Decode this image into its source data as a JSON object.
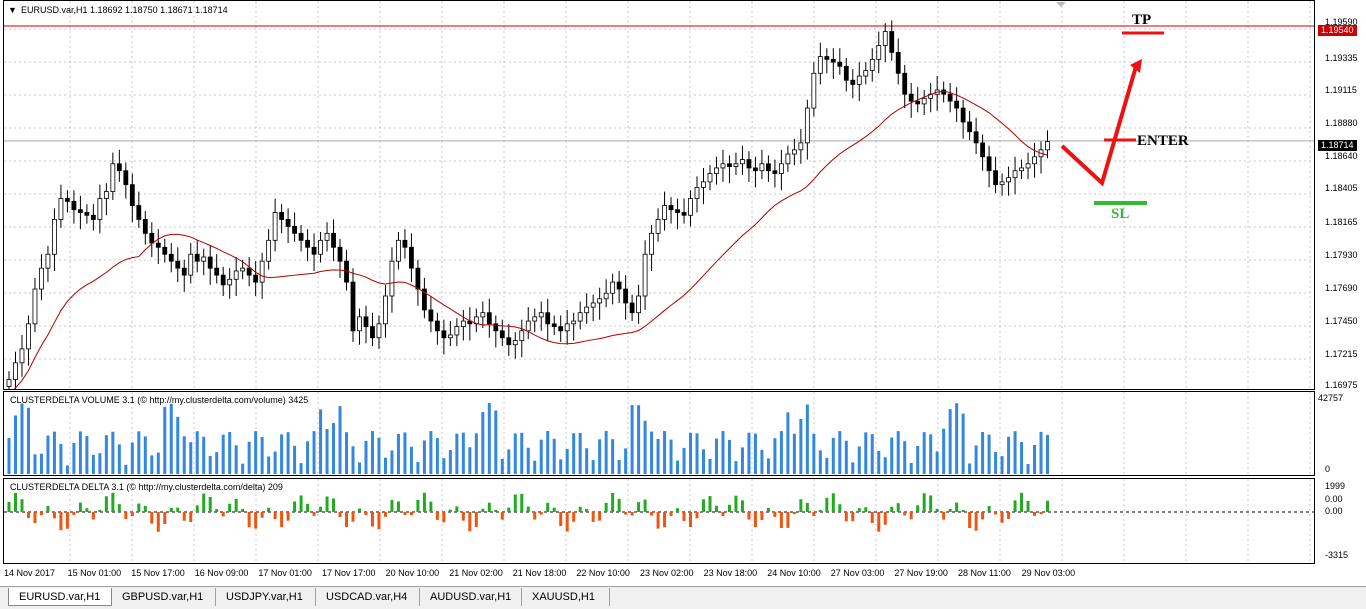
{
  "chart_header": {
    "title": "EURUSD.var,H1  1.18692 1.18750 1.18671 1.18714",
    "dropdown_glyph": "▼"
  },
  "price_scale": [
    "1.19590",
    "1.19540",
    "1.19335",
    "1.19115",
    "1.18880",
    "1.18714",
    "1.18640",
    "1.18405",
    "1.18165",
    "1.17930",
    "1.17690",
    "1.17450",
    "1.17215",
    "1.16975"
  ],
  "tp_price": "1.19540",
  "current_price": "1.18714",
  "annotations": {
    "tp": "TP",
    "enter": "ENTER",
    "sl": "SL"
  },
  "colors": {
    "tp_line": "#cc0000",
    "ma_line": "#b00000",
    "up_bar": "#22aa22",
    "down_bar": "#ee5511",
    "volume": "#3388dd",
    "annot_red": "#ee1111",
    "annot_green": "#33bb33"
  },
  "volume_indicator": {
    "title": "CLUSTERDELTA VOLUME 3.1 (© http://my.clusterdelta.com/volume) 3425",
    "scale_top": "42757",
    "scale_bottom": "0"
  },
  "delta_indicator": {
    "title": "CLUSTERDELTA DELTA 3.1 (© http://my.clusterdelta.com/delta) 209",
    "scale_top": "1999",
    "scale_mid": "0.00",
    "scale_zero": "0.00",
    "scale_bottom": "-3315"
  },
  "time_axis": [
    "14 Nov 2017",
    "15 Nov 01:00",
    "15 Nov 17:00",
    "16 Nov 09:00",
    "17 Nov 01:00",
    "17 Nov 17:00",
    "20 Nov 10:00",
    "21 Nov 02:00",
    "21 Nov 18:00",
    "22 Nov 10:00",
    "23 Nov 02:00",
    "23 Nov 18:00",
    "24 Nov 10:00",
    "27 Nov 03:00",
    "27 Nov 19:00",
    "28 Nov 11:00",
    "29 Nov 03:00"
  ],
  "tabs": [
    {
      "label": "EURUSD.var,H1",
      "active": true
    },
    {
      "label": "GBPUSD.var,H1",
      "active": false
    },
    {
      "label": "USDJPY.var,H1",
      "active": false
    },
    {
      "label": "USDCAD.var,H4",
      "active": false
    },
    {
      "label": "AUDUSD.var,H1",
      "active": false
    },
    {
      "label": "XAUUSD,H1",
      "active": false
    }
  ],
  "chart_data": {
    "type": "candlestick",
    "price_range": [
      1.16975,
      1.1959
    ],
    "closes": [
      1.17,
      1.1712,
      1.1722,
      1.174,
      1.1765,
      1.178,
      1.179,
      1.1815,
      1.183,
      1.1828,
      1.1822,
      1.182,
      1.1818,
      1.1815,
      1.183,
      1.1835,
      1.1855,
      1.185,
      1.184,
      1.1825,
      1.1815,
      1.1805,
      1.1798,
      1.1795,
      1.179,
      1.1785,
      1.178,
      1.1775,
      1.179,
      1.1785,
      1.1788,
      1.178,
      1.1775,
      1.1768,
      1.1772,
      1.1778,
      1.178,
      1.1775,
      1.177,
      1.1785,
      1.18,
      1.182,
      1.1815,
      1.181,
      1.1805,
      1.18,
      1.1795,
      1.179,
      1.18,
      1.1805,
      1.1795,
      1.1785,
      1.177,
      1.1735,
      1.1745,
      1.1738,
      1.173,
      1.174,
      1.176,
      1.1785,
      1.18,
      1.1795,
      1.178,
      1.1765,
      1.175,
      1.1742,
      1.1735,
      1.173,
      1.1732,
      1.1738,
      1.1742,
      1.174,
      1.1745,
      1.1748,
      1.174,
      1.1735,
      1.173,
      1.1725,
      1.1728,
      1.1735,
      1.1742,
      1.1745,
      1.1748,
      1.174,
      1.1738,
      1.1735,
      1.174,
      1.1742,
      1.1748,
      1.1752,
      1.1755,
      1.1758,
      1.1762,
      1.177,
      1.1765,
      1.1755,
      1.1748,
      1.176,
      1.179,
      1.1805,
      1.1815,
      1.1825,
      1.1822,
      1.182,
      1.1818,
      1.183,
      1.1838,
      1.1842,
      1.1848,
      1.1852,
      1.1855,
      1.1853,
      1.1855,
      1.1858,
      1.1852,
      1.185,
      1.1855,
      1.185,
      1.1848,
      1.1855,
      1.1862,
      1.1865,
      1.187,
      1.1895,
      1.192,
      1.1932,
      1.193,
      1.1928,
      1.1925,
      1.1915,
      1.1912,
      1.1918,
      1.1922,
      1.193,
      1.194,
      1.195,
      1.1935,
      1.192,
      1.1905,
      1.19,
      1.1898,
      1.1902,
      1.1905,
      1.1908,
      1.1905,
      1.19,
      1.1895,
      1.1885,
      1.1878,
      1.187,
      1.186,
      1.185,
      1.184,
      1.1842,
      1.1845,
      1.185,
      1.1852,
      1.1855,
      1.186,
      1.1865,
      1.1871
    ]
  }
}
